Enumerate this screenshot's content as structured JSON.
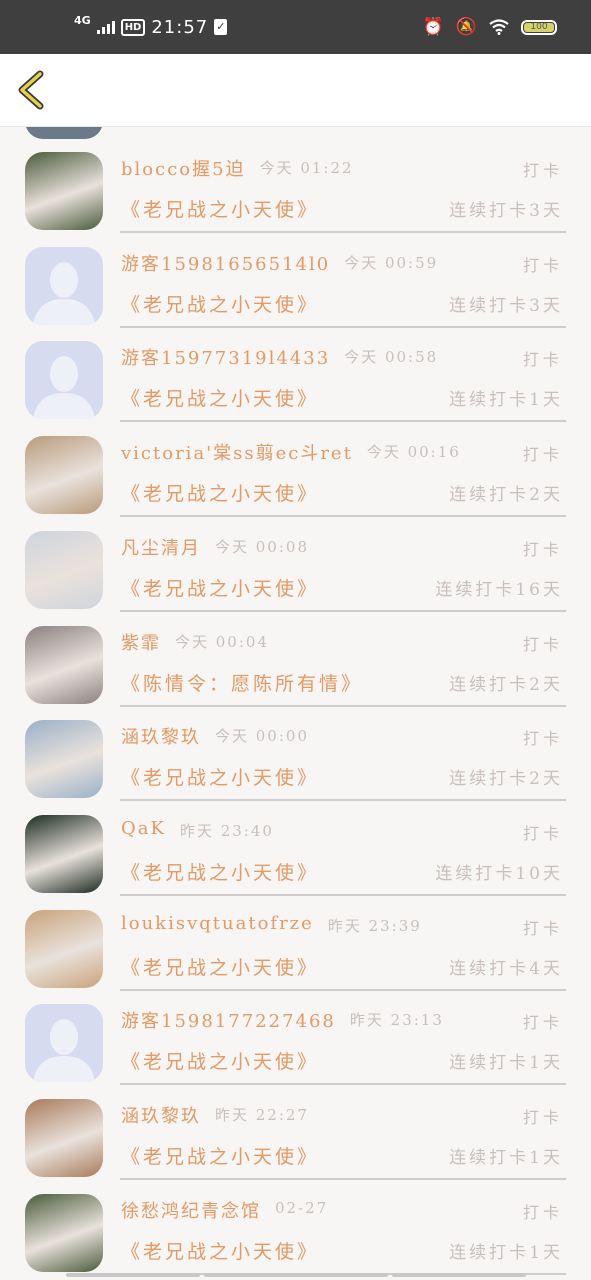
{
  "status_bar": {
    "network": "4G",
    "hd": "HD",
    "time": "21:57",
    "battery": "100"
  },
  "header": {
    "back_icon": "chevron-left-icon"
  },
  "colors": {
    "accent": "#e49a64",
    "muted": "#c9c0bb",
    "back_arrow": "#e6d24a"
  },
  "entries": [
    {
      "name": "blocco握5迫",
      "time": "今天 01:22",
      "action": "打卡",
      "book": "《老兄战之小天使》",
      "streak": "连续打卡3天",
      "avatar": "photo"
    },
    {
      "name": "游客15981656514l0",
      "time": "今天 00:59",
      "action": "打卡",
      "book": "《老兄战之小天使》",
      "streak": "连续打卡3天",
      "avatar": "default"
    },
    {
      "name": "游客15977319l4433",
      "time": "今天 00:58",
      "action": "打卡",
      "book": "《老兄战之小天使》",
      "streak": "连续打卡1天",
      "avatar": "default"
    },
    {
      "name": "victoria'棠ss翦ec斗ret",
      "time": "今天 00:16",
      "action": "打卡",
      "book": "《老兄战之小天使》",
      "streak": "连续打卡2天",
      "avatar": "photo"
    },
    {
      "name": "凡尘清月",
      "time": "今天 00:08",
      "action": "打卡",
      "book": "《老兄战之小天使》",
      "streak": "连续打卡16天",
      "avatar": "photo"
    },
    {
      "name": "紫霏",
      "time": "今天 00:04",
      "action": "打卡",
      "book": "《陈情令：愿陈所有情》",
      "streak": "连续打卡2天",
      "avatar": "photo"
    },
    {
      "name": "涵玖黎玖",
      "time": "今天 00:00",
      "action": "打卡",
      "book": "《老兄战之小天使》",
      "streak": "连续打卡2天",
      "avatar": "photo"
    },
    {
      "name": "QaK",
      "time": "昨天 23:40",
      "action": "打卡",
      "book": "《老兄战之小天使》",
      "streak": "连续打卡10天",
      "avatar": "photo"
    },
    {
      "name": "loukisvqtuatofrze",
      "time": "昨天 23:39",
      "action": "打卡",
      "book": "《老兄战之小天使》",
      "streak": "连续打卡4天",
      "avatar": "photo"
    },
    {
      "name": "游客15981772274​68",
      "time": "昨天 23:13",
      "action": "打卡",
      "book": "《老兄战之小天使》",
      "streak": "连续打卡1天",
      "avatar": "default"
    },
    {
      "name": "涵玖黎玖",
      "time": "昨天 22:27",
      "action": "打卡",
      "book": "《老兄战之小天使》",
      "streak": "连续打卡1天",
      "avatar": "photo"
    },
    {
      "name": "徐愁鸿纪青念馆",
      "time": "02-27",
      "action": "打卡",
      "book": "《老兄战之小天使》",
      "streak": "连续打卡1天",
      "avatar": "photo"
    }
  ]
}
